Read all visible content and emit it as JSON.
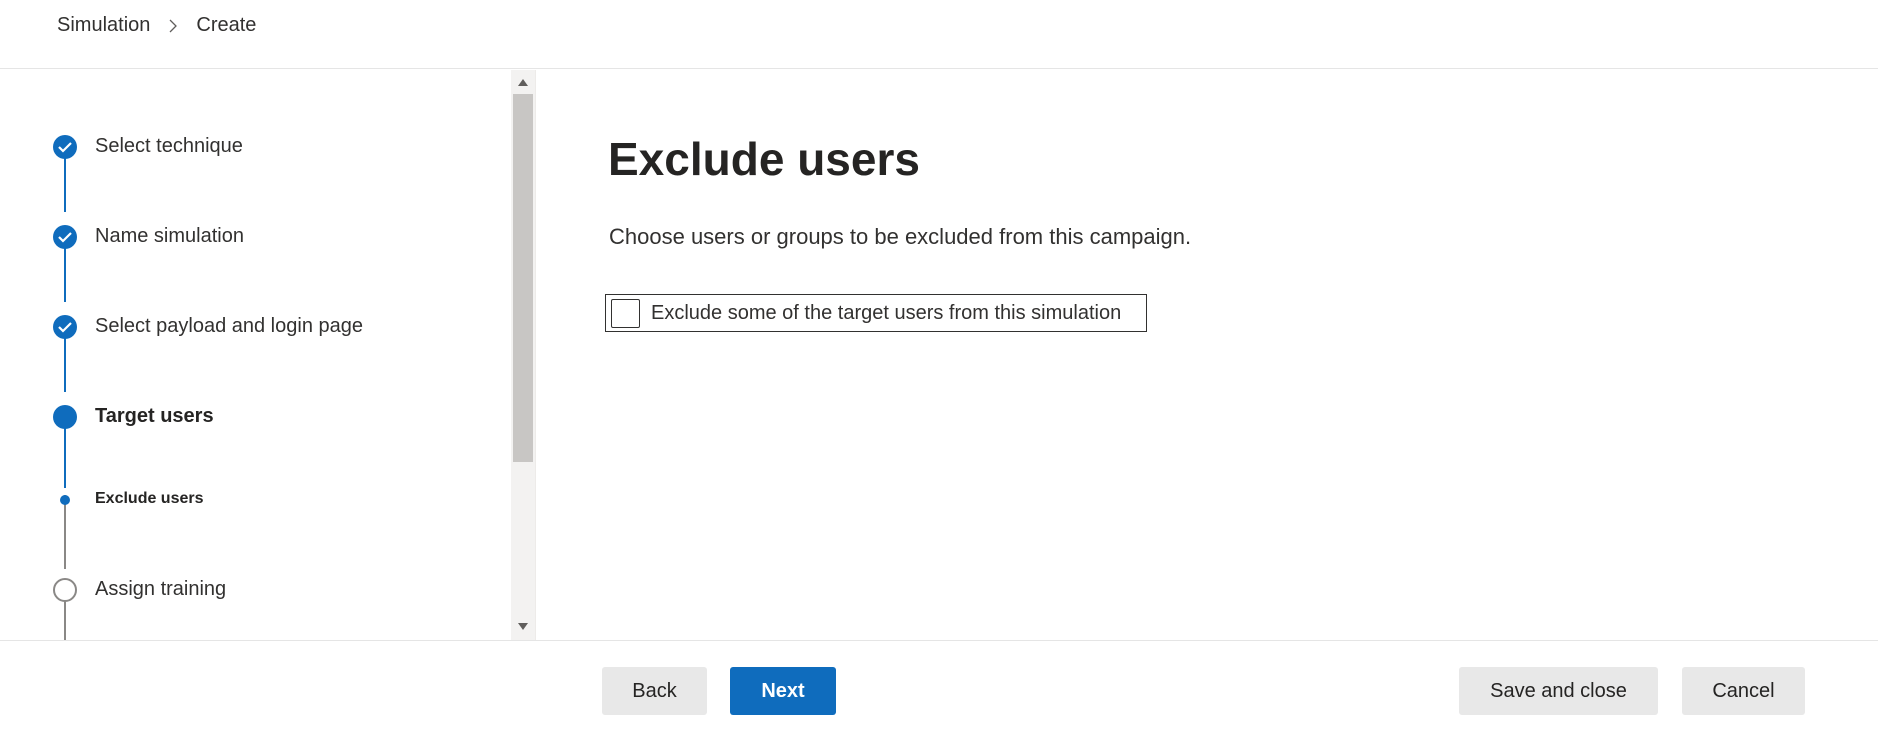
{
  "breadcrumb": {
    "items": [
      "Simulation",
      "Create"
    ]
  },
  "steps": [
    {
      "label": "Select technique",
      "state": "done"
    },
    {
      "label": "Name simulation",
      "state": "done"
    },
    {
      "label": "Select payload and login page",
      "state": "done"
    },
    {
      "label": "Target users",
      "state": "current"
    },
    {
      "label": "Exclude users",
      "state": "current-substep"
    },
    {
      "label": "Assign training",
      "state": "pending"
    }
  ],
  "main": {
    "title": "Exclude users",
    "description": "Choose users or groups to be excluded from this campaign.",
    "exclude_checkbox": {
      "label": "Exclude some of the target users from this simulation",
      "checked": false
    }
  },
  "footer": {
    "back_label": "Back",
    "next_label": "Next",
    "save_label": "Save and close",
    "cancel_label": "Cancel"
  },
  "colors": {
    "accent": "#0f6cbd",
    "pending": "#8a8886"
  },
  "icons": {
    "breadcrumb_separator": "chevron-right-icon",
    "step_done": "checkmark-icon",
    "scroll_up": "caret-up-icon",
    "scroll_down": "caret-down-icon"
  }
}
